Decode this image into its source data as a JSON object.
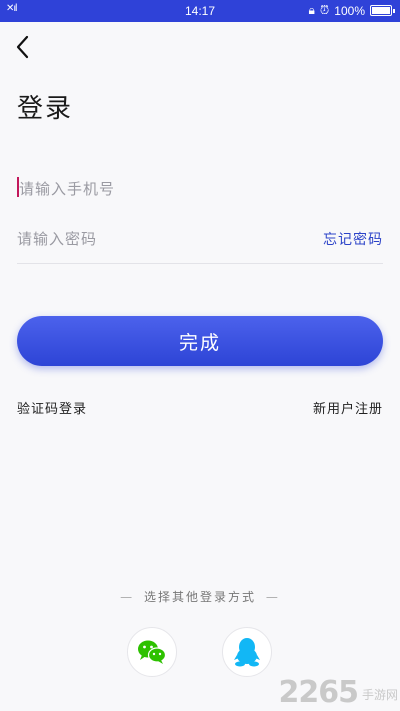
{
  "status_bar": {
    "time": "14:17",
    "battery": "100%",
    "battery_level": 1.0
  },
  "header": {
    "title": "登录"
  },
  "form": {
    "phone_placeholder": "请输入手机号",
    "password_placeholder": "请输入密码",
    "forgot_password": "忘记密码",
    "submit_label": "完成"
  },
  "links": {
    "sms_login": "验证码登录",
    "register": "新用户注册"
  },
  "other_login": {
    "label": "选择其他登录方式",
    "dash": "—",
    "providers": [
      "wechat-icon",
      "qq-icon"
    ]
  },
  "watermark": {
    "number": "2265",
    "text": "手游网"
  },
  "colors": {
    "accent": "#2f42d8",
    "link": "#2c43c8",
    "wechat": "#2dc100",
    "qq": "#12b7f5"
  }
}
